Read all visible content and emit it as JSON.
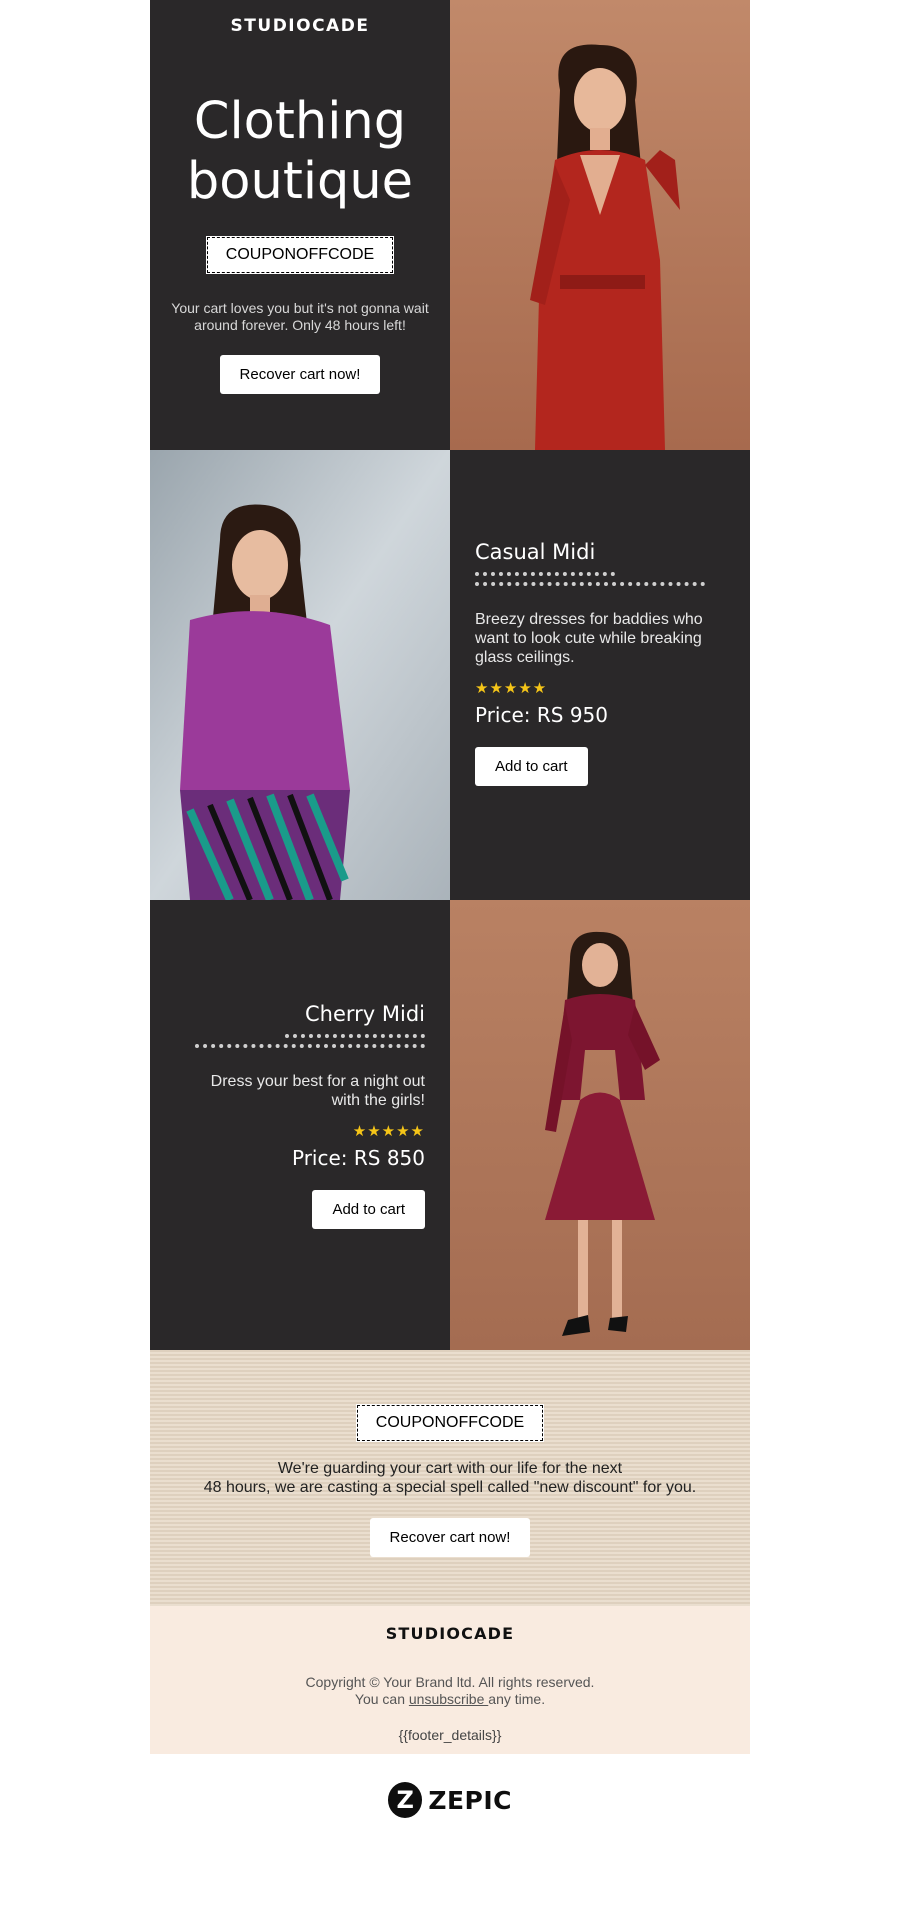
{
  "hero": {
    "brand": "STUDIOCADE",
    "title_line1": "Clothing",
    "title_line2": "boutique",
    "coupon": "COUPONOFFCODE",
    "text": "Your cart loves you but it's not gonna wait around forever. Only 48 hours left!",
    "button": "Recover cart now!"
  },
  "products": [
    {
      "title": "Casual Midi",
      "description": "Breezy dresses for baddies who want to look cute while breaking glass ceilings.",
      "rating": 5,
      "stars": "★★★★★",
      "price": "Price: RS 950",
      "button": "Add to cart"
    },
    {
      "title": "Cherry Midi",
      "description": "Dress your best for a night out with the girls!",
      "rating": 5,
      "stars": "★★★★★",
      "price": "Price: RS 850",
      "button": "Add to cart"
    }
  ],
  "coupon_section": {
    "coupon": "COUPONOFFCODE",
    "text_line1": "We're guarding your cart with our life for the next",
    "text_line2": "48 hours, we are casting a special spell called \"new discount\" for you.",
    "button": "Recover cart now!"
  },
  "footer": {
    "brand": "STUDIOCADE",
    "copyright": "Copyright © Your Brand ltd. All rights reserved.",
    "unsub_prefix": "You can ",
    "unsub_link": "unsubscribe ",
    "unsub_suffix": "any time.",
    "details": "{{footer_details}}"
  },
  "powered_by": {
    "badge": "Z",
    "name": "ZEPIC"
  },
  "colors": {
    "dark_bg": "#2a2829",
    "star": "#f5c518",
    "coupon_bg": "#e5d7c4",
    "footer_bg": "#f9ebe0"
  }
}
